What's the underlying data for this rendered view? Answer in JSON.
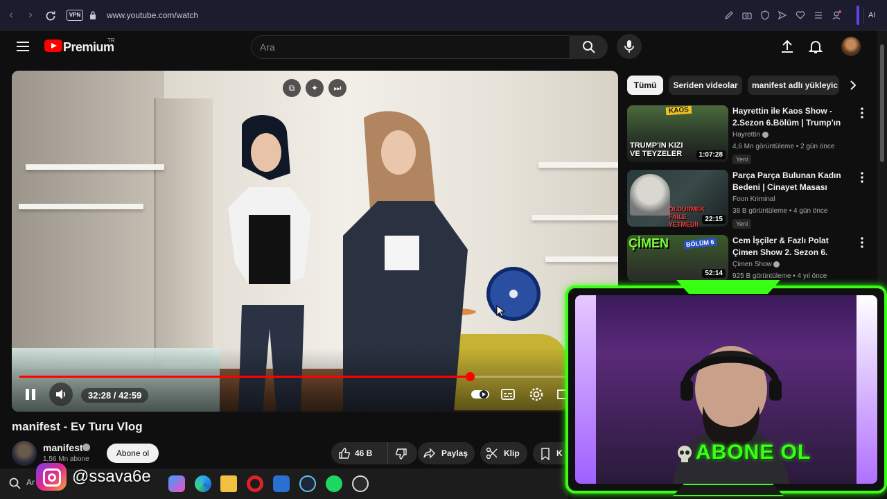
{
  "browser": {
    "url": "www.youtube.com/watch",
    "vpn_label": "VPN",
    "ai_label": "AI"
  },
  "header": {
    "logo_text": "Premium",
    "region": "TR",
    "search_placeholder": "Ara"
  },
  "chips": [
    {
      "label": "Tümü",
      "active": true
    },
    {
      "label": "Seriden videolar",
      "active": false
    },
    {
      "label": "manifest adlı yükleyic",
      "active": false
    }
  ],
  "player": {
    "current_time": "32:28",
    "duration": "42:59",
    "time_display": "32:28 / 42:59",
    "progress": 0.765
  },
  "video": {
    "title": "manifest - Ev Turu Vlog",
    "channel": "manifest",
    "subscribers": "1,56 Mn abone",
    "subscribe_label": "Abone ol",
    "likes": "46 B",
    "share_label": "Paylaş",
    "clip_label": "Klip",
    "save_label": "K"
  },
  "recommended": [
    {
      "title": "Hayrettin ile Kaos Show - 2.Sezon 6.Bölüm | Trump'ın Kı...",
      "channel": "Hayrettin",
      "verified": true,
      "meta": "4,6 Mn görüntüleme • 2 gün önce",
      "badge": "Yeni",
      "duration": "1:07:28",
      "thumb_text": "TRUMP'IN KIZI VE TEYZELER",
      "thumb_label": "KAOS"
    },
    {
      "title": "Parça Parça Bulunan Kadın Bedeni | Cinayet Masası",
      "channel": "Foon Kriminal",
      "verified": false,
      "meta": "38 B görüntüleme • 4 gün önce",
      "badge": "Yeni",
      "duration": "22:15",
      "thumb_text": "ÖLDÜRMEK FAİLE YETMEDİ!"
    },
    {
      "title": "Cem İşçiler & Fazlı Polat Çimen Show 2. Sezon 6. Bölüm - ...",
      "channel": "Çimen Show",
      "verified": true,
      "meta": "925 B görüntüleme • 4 yıl önce",
      "badge": "",
      "duration": "52:14",
      "thumb_text": "ÇİMEN",
      "thumb_label": "BÖLÜM 6"
    }
  ],
  "overlay": {
    "abone_text": "ABONE OL",
    "instagram_handle": "@ssava6e"
  },
  "taskbar": {
    "search_text": "Ar"
  },
  "colors": {
    "accent": "#ff0000",
    "webcam_frame": "#39ff14",
    "background": "#0f0f0f"
  }
}
